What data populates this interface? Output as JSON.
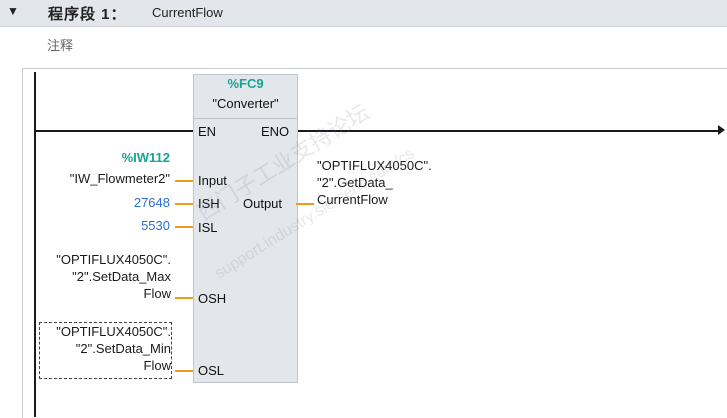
{
  "header": {
    "collapse_icon": "collapse-triangle-icon",
    "title": "程序段 1：",
    "network_name": "CurrentFlow"
  },
  "comment": {
    "label": "注释"
  },
  "block": {
    "address": "%FC9",
    "name": "\"Converter\"",
    "pins": {
      "en": "EN",
      "eno": "ENO",
      "input": "Input",
      "ish": "ISH",
      "isl": "ISL",
      "osh": "OSH",
      "osl": "OSL",
      "output": "Output"
    }
  },
  "operands": {
    "input_address": "%IW112",
    "input_tag": "\"IW_Flowmeter2\"",
    "ish_value": "27648",
    "isl_value": "5530",
    "osh_line1": "\"OPTIFLUX4050C\".",
    "osh_line2": "\"2\".SetData_Max",
    "osh_line3": "Flow",
    "osl_line1": "\"OPTIFLUX4050C\".",
    "osl_line2": "\"2\".SetData_Min",
    "osl_line3": "Flow",
    "output_line1": "\"OPTIFLUX4050C\".",
    "output_line2": "\"2\".GetData_",
    "output_line3": "CurrentFlow"
  },
  "watermark": {
    "line1": "西门子工业支持论坛",
    "line2": "support.industry.siemens.com/cs"
  },
  "colors": {
    "header_bg": "#e3e6ea",
    "block_bg": "#e3e6ea",
    "wire_orange": "#f19b1a",
    "address_teal": "#17a397",
    "constant_blue": "#2e6fd0"
  }
}
